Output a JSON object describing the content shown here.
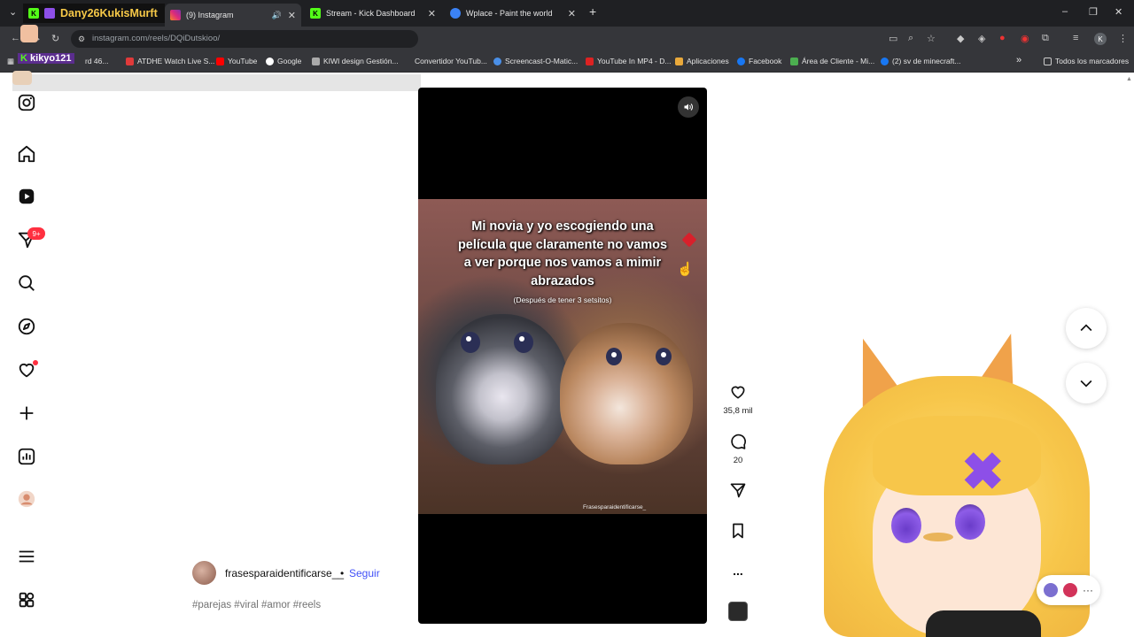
{
  "browser": {
    "tabs": [
      {
        "label": "Dany26KukisMurft",
        "overlay": true
      },
      {
        "label": "(9) Instagram",
        "active": true
      },
      {
        "label": "Stream - Kick Dashboard"
      },
      {
        "label": "Wplace - Paint the world"
      }
    ],
    "new_tab": "+",
    "window_controls": [
      "–",
      "❐",
      "✕"
    ],
    "url": "instagram.com/reels/DQiDutskioo/",
    "profile_initial": "K",
    "bookmarks": [
      "rd 46...",
      "ATDHE Watch Live S...",
      "YouTube",
      "Google",
      "KIWI design Gestión...",
      "Convertidor YouTub...",
      "Screencast-O-Matic...",
      "YouTube In MP4 - D...",
      "Aplicaciones",
      "Facebook",
      "Área de Cliente - Mi...",
      "(2) sv de minecraft...",
      "Todos los marcadores"
    ],
    "bookmark_more": "»"
  },
  "overlay": {
    "title": "Dany26KukisMurft",
    "kiko": "kikyo121"
  },
  "sidebar": {
    "notification_badge": "9+"
  },
  "reel": {
    "caption": "Mi novia y yo escogiendo una película que claramente no vamos a ver porque nos vamos a mimir abrazados",
    "subcaption": "(Después de tener 3 setsitos)",
    "watermark": "Frasesparaidentificarse_"
  },
  "actions": {
    "likes": "35,8 mil",
    "comments": "20",
    "more": "..."
  },
  "author": {
    "name": "frasesparaidentificarse__",
    "bullet": "•",
    "follow": "Seguir",
    "hashtags": "#parejas #viral #amor #reels"
  },
  "messages": {
    "more": "···"
  },
  "colors": {
    "accent_blue": "#4150f7",
    "badge_red": "#ff3040",
    "overlay_gold": "#f7c948"
  }
}
